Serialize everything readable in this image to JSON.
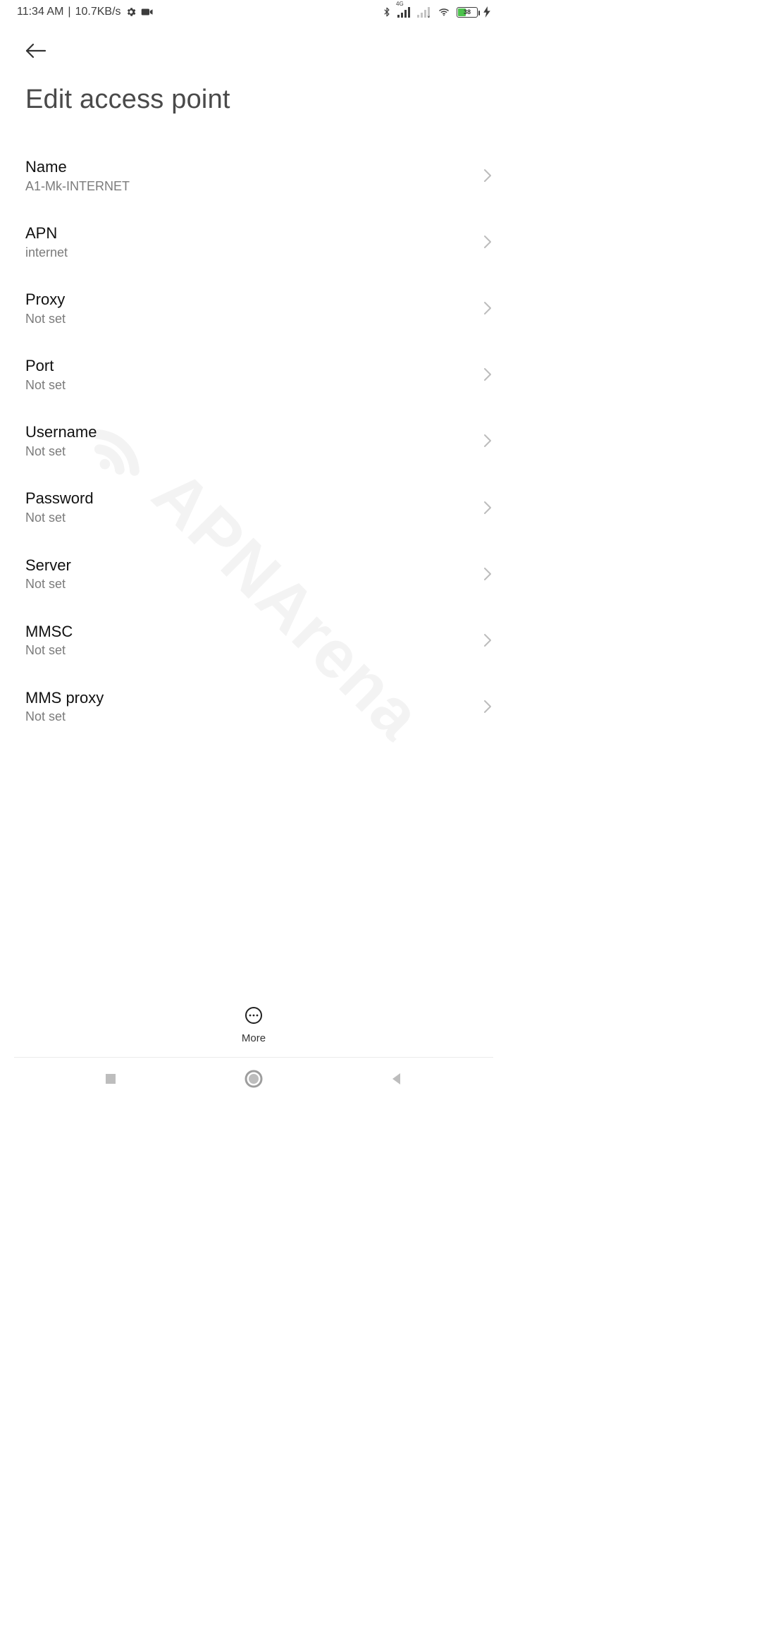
{
  "status": {
    "time": "11:34 AM",
    "separator": "|",
    "net_speed": "10.7KB/s",
    "network_badge": "4G",
    "battery_pct": "38"
  },
  "header": {
    "title": "Edit access point"
  },
  "items": [
    {
      "label": "Name",
      "value": "A1-Mk-INTERNET"
    },
    {
      "label": "APN",
      "value": "internet"
    },
    {
      "label": "Proxy",
      "value": "Not set"
    },
    {
      "label": "Port",
      "value": "Not set"
    },
    {
      "label": "Username",
      "value": "Not set"
    },
    {
      "label": "Password",
      "value": "Not set"
    },
    {
      "label": "Server",
      "value": "Not set"
    },
    {
      "label": "MMSC",
      "value": "Not set"
    },
    {
      "label": "MMS proxy",
      "value": "Not set"
    }
  ],
  "toolbar": {
    "more_label": "More"
  },
  "watermark": "APNArena"
}
